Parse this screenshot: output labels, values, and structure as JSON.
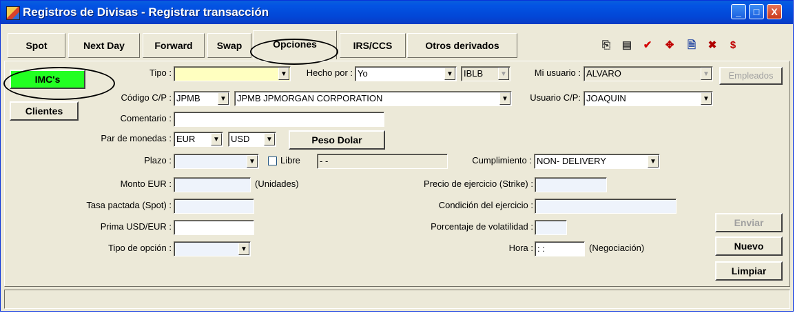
{
  "window": {
    "title": "Registros de Divisas - Registrar transacción",
    "controls": {
      "minimize": "_",
      "maximize": "□",
      "close": "X"
    }
  },
  "tabs": [
    {
      "label": "Spot"
    },
    {
      "label": "Next Day"
    },
    {
      "label": "Forward"
    },
    {
      "label": "Swap"
    },
    {
      "label": "Opciones",
      "active": true
    },
    {
      "label": "IRS/CCS"
    },
    {
      "label": "Otros derivados"
    }
  ],
  "toolbar_icons": [
    "copy-doc-icon",
    "notes-icon",
    "check-approve-icon",
    "move-arrows-icon",
    "document-icon",
    "delete-doc-icon",
    "cash-icon"
  ],
  "buttons": {
    "imcs": "IMC's",
    "clientes": "Clientes",
    "empleados": "Empleados",
    "peso_dolar": "Peso Dolar",
    "enviar": "Enviar",
    "nuevo": "Nuevo",
    "limpiar": "Limpiar"
  },
  "form": {
    "tipo": {
      "label": "Tipo :",
      "value": ""
    },
    "hecho_por": {
      "label": "Hecho por :",
      "value": "Yo",
      "extra": "IBLB"
    },
    "mi_usuario": {
      "label": "Mi usuario :",
      "value": "ALVARO"
    },
    "codigo_cp": {
      "label": "Código C/P :",
      "code": "JPMB",
      "name": "JPMB  JPMORGAN CORPORATION"
    },
    "usuario_cp": {
      "label": "Usuario C/P:",
      "value": "JOAQUIN"
    },
    "comentario": {
      "label": "Comentario :",
      "value": ""
    },
    "par_monedas": {
      "label": "Par de monedas :",
      "base": "EUR",
      "quote": "USD"
    },
    "plazo": {
      "label": "Plazo :",
      "value": ""
    },
    "libre": {
      "label": "Libre",
      "date": " -  -"
    },
    "cumplimiento": {
      "label": "Cumplimiento :",
      "value": "NON- DELIVERY"
    },
    "monto": {
      "label": "Monto EUR :",
      "value": "",
      "units": "(Unidades)"
    },
    "precio_ejercicio": {
      "label": "Precio de ejercicio (Strike) :",
      "value": ""
    },
    "tasa_pactada": {
      "label": "Tasa pactada (Spot) :",
      "value": ""
    },
    "condicion": {
      "label": "Condición del ejercicio :",
      "value": ""
    },
    "prima": {
      "label": "Prima USD/EUR :",
      "value": ""
    },
    "volatilidad": {
      "label": "Porcentaje de volatilidad :",
      "value": ""
    },
    "tipo_opcion": {
      "label": "Tipo de opción :",
      "value": ""
    },
    "hora": {
      "label": "Hora :",
      "value": " :  :",
      "note": "(Negociación)"
    }
  },
  "colors": {
    "title_bar": "#0354e3",
    "imcs_button": "#22ff22",
    "tipo_field": "#ffffc0"
  }
}
